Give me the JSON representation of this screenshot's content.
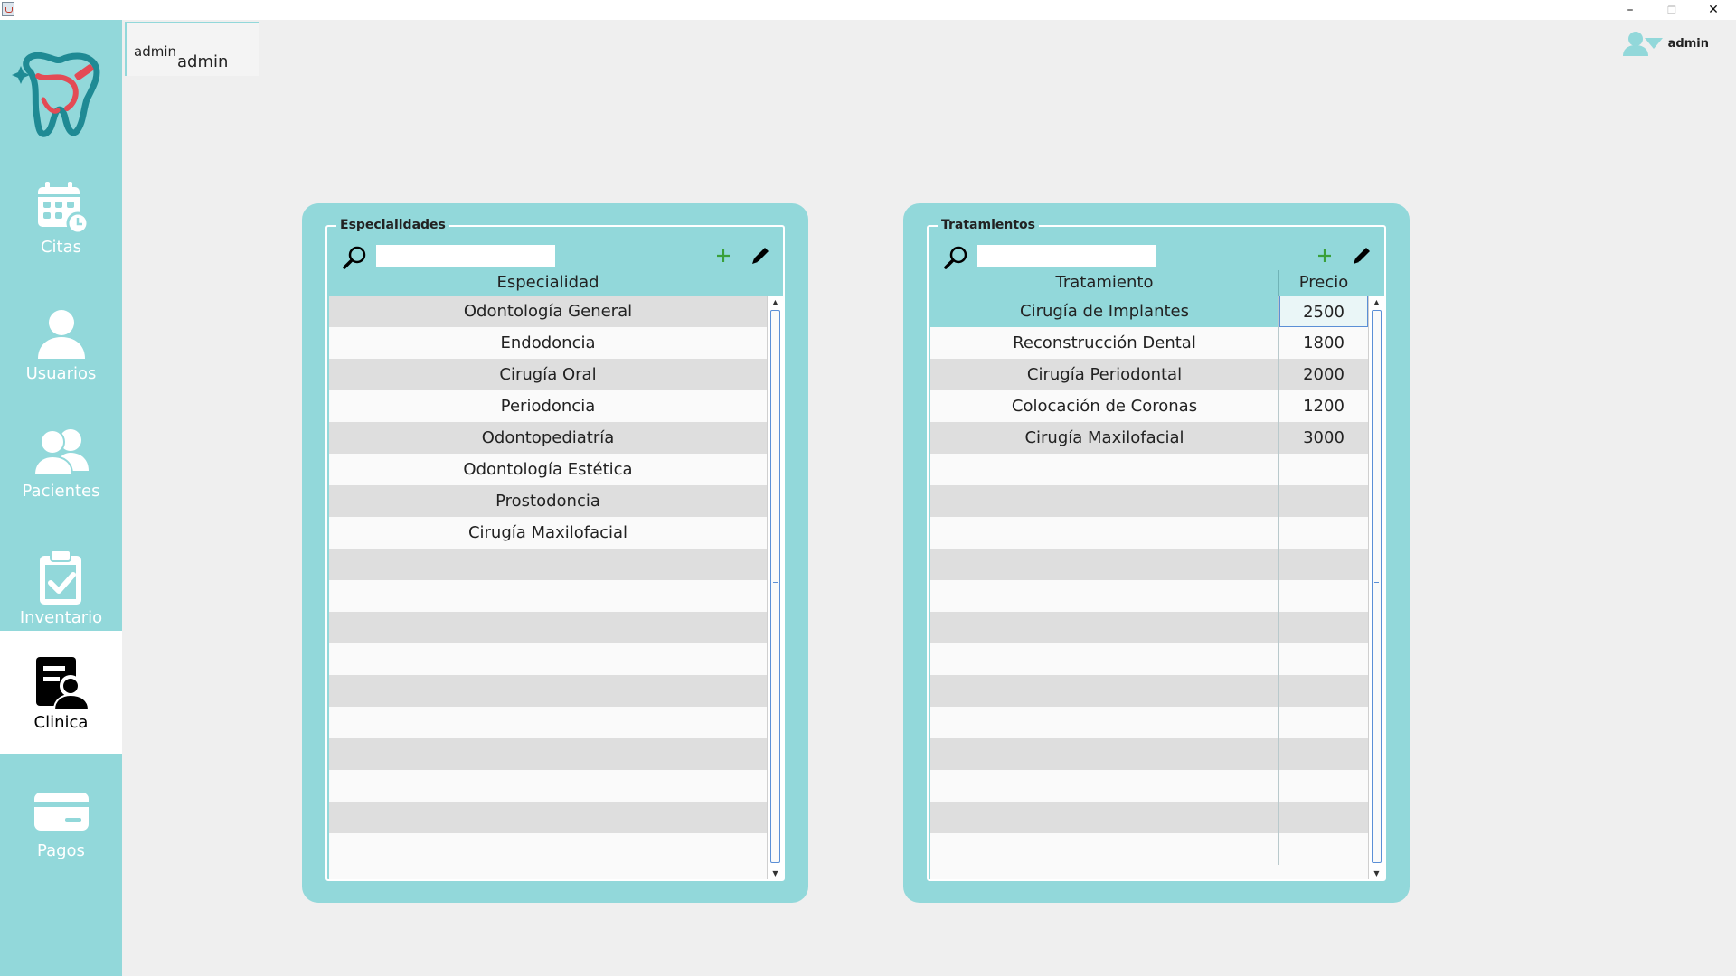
{
  "window": {
    "minimize_label": "–",
    "maximize_label": "❐",
    "close_label": "✕"
  },
  "sidebar": {
    "items": [
      {
        "label": "Citas",
        "icon": "calendar-icon"
      },
      {
        "label": "Usuarios",
        "icon": "user-icon"
      },
      {
        "label": "Pacientes",
        "icon": "patients-icon"
      },
      {
        "label": "Inventario",
        "icon": "clipboard-check-icon"
      },
      {
        "label": "Clinica",
        "icon": "clinic-icon",
        "active": true
      },
      {
        "label": "Pagos",
        "icon": "card-icon"
      }
    ]
  },
  "user_tab": {
    "small": "admin",
    "big": "admin"
  },
  "top_user": {
    "name": "admin",
    "icon": "user-dropdown-icon"
  },
  "colors": {
    "accent": "#92d8da",
    "row_alt": "#dedede",
    "add_green": "#3aa03a"
  },
  "especialidades": {
    "title": "Especialidades",
    "search_value": "",
    "column_header": "Especialidad",
    "rows": [
      "Odontología General",
      "Endodoncia",
      "Cirugía Oral",
      "Periodoncia",
      "Odontopediatría",
      "Odontología Estética",
      "Prostodoncia",
      "Cirugía Maxilofacial",
      "",
      "",
      "",
      "",
      "",
      "",
      "",
      "",
      "",
      ""
    ]
  },
  "tratamientos": {
    "title": "Tratamientos",
    "search_value": "",
    "column_headers": [
      "Tratamiento",
      "Precio"
    ],
    "rows": [
      {
        "tratamiento": "Cirugía de Implantes",
        "precio": "2500",
        "selected": true
      },
      {
        "tratamiento": "Reconstrucción Dental",
        "precio": "1800"
      },
      {
        "tratamiento": "Cirugía Periodontal",
        "precio": "2000"
      },
      {
        "tratamiento": "Colocación de Coronas",
        "precio": "1200"
      },
      {
        "tratamiento": "Cirugía Maxilofacial",
        "precio": "3000"
      },
      {
        "tratamiento": "",
        "precio": ""
      },
      {
        "tratamiento": "",
        "precio": ""
      },
      {
        "tratamiento": "",
        "precio": ""
      },
      {
        "tratamiento": "",
        "precio": ""
      },
      {
        "tratamiento": "",
        "precio": ""
      },
      {
        "tratamiento": "",
        "precio": ""
      },
      {
        "tratamiento": "",
        "precio": ""
      },
      {
        "tratamiento": "",
        "precio": ""
      },
      {
        "tratamiento": "",
        "precio": ""
      },
      {
        "tratamiento": "",
        "precio": ""
      },
      {
        "tratamiento": "",
        "precio": ""
      },
      {
        "tratamiento": "",
        "precio": ""
      },
      {
        "tratamiento": "",
        "precio": ""
      }
    ]
  }
}
